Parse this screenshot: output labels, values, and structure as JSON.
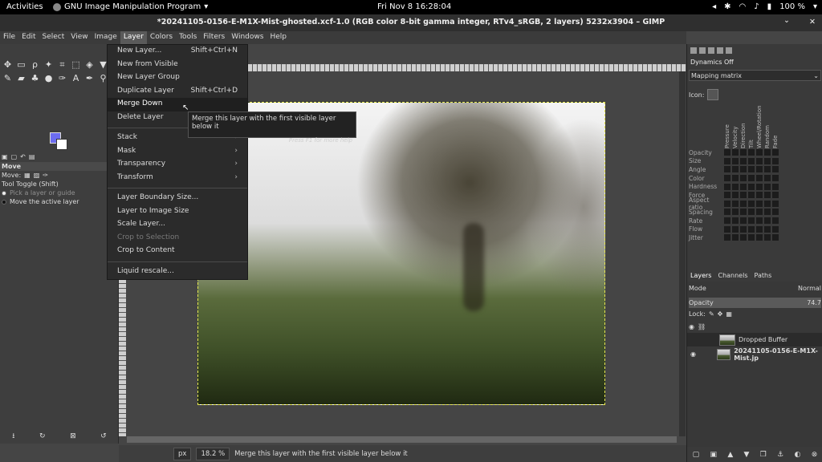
{
  "topbar": {
    "activities": "Activities",
    "app_name": "GNU Image Manipulation Program",
    "clock": "Fri Nov 8  16:28:04",
    "battery": "100 %"
  },
  "window": {
    "title": "*20241105-0156-E-M1X-Mist-ghosted.xcf-1.0 (RGB color 8-bit gamma integer, RTv4_sRGB, 2 layers) 5232x3904 – GIMP",
    "close": "✕",
    "minimize": "⌄"
  },
  "menubar": [
    "File",
    "Edit",
    "Select",
    "View",
    "Image",
    "Layer",
    "Colors",
    "Tools",
    "Filters",
    "Windows",
    "Help"
  ],
  "layer_menu": {
    "items": [
      {
        "label": "New Layer...",
        "shortcut": "Shift+Ctrl+N"
      },
      {
        "label": "New from Visible",
        "shortcut": ""
      },
      {
        "label": "New Layer Group",
        "shortcut": ""
      },
      {
        "label": "Duplicate Layer",
        "shortcut": "Shift+Ctrl+D"
      },
      {
        "label": "Merge Down",
        "shortcut": ""
      },
      {
        "label": "Delete Layer",
        "shortcut": ""
      }
    ],
    "submenus": [
      "Stack",
      "Mask",
      "Transparency",
      "Transform"
    ],
    "items2": [
      "Layer Boundary Size...",
      "Layer to Image Size",
      "Scale Layer...",
      "Crop to Selection",
      "Crop to Content"
    ],
    "items3": [
      "Liquid rescale..."
    ]
  },
  "tooltip": {
    "text": "Merge this layer with the first visible layer below it",
    "hint": "Press F1 for more help"
  },
  "tool_options": {
    "title": "Move",
    "move_label": "Move:",
    "toggle": "Tool Toggle  (Shift)",
    "opt1": "Pick a layer or guide",
    "opt2": "Move the active layer"
  },
  "statusbar": {
    "unit": "px",
    "zoom": "18.2 %",
    "message": "Merge this layer with the first visible layer below it"
  },
  "dynamics": {
    "name": "Dynamics Off",
    "mapping": "Mapping matrix",
    "icon_label": "Icon:",
    "columns": [
      "Pressure",
      "Velocity",
      "Direction",
      "Tilt",
      "Wheel/Rotation",
      "Random",
      "Fade"
    ],
    "rows": [
      "Opacity",
      "Size",
      "Angle",
      "Color",
      "Hardness",
      "Force",
      "Aspect ratio",
      "Spacing",
      "Rate",
      "Flow",
      "Jitter"
    ]
  },
  "layers_panel": {
    "tabs": [
      "Layers",
      "Channels",
      "Paths"
    ],
    "mode_label": "Mode",
    "mode_value": "Normal",
    "opacity_label": "Opacity",
    "opacity_value": "74.7",
    "lock_label": "Lock:",
    "layers": [
      "Dropped Buffer",
      "20241105-0156-E-M1X-Mist.jp"
    ]
  },
  "colors": {
    "foreground": "#6c6cf0",
    "background": "#ffffff",
    "selection_border": "#e6e650"
  }
}
